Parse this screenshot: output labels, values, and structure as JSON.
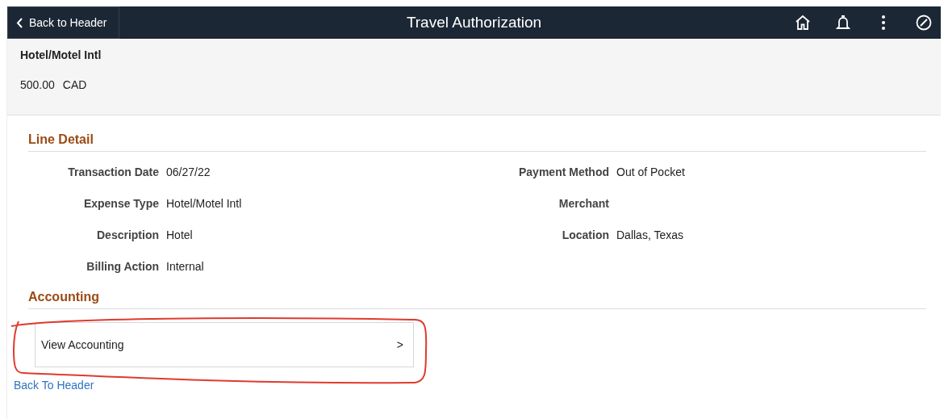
{
  "header": {
    "back_button": "Back to Header",
    "title": "Travel Authorization"
  },
  "summary": {
    "name": "Hotel/Motel Intl",
    "amount": "500.00",
    "currency": "CAD"
  },
  "line_detail": {
    "heading": "Line Detail",
    "left_fields": [
      {
        "label": "Transaction Date",
        "value": "06/27/22"
      },
      {
        "label": "Expense Type",
        "value": "Hotel/Motel Intl"
      },
      {
        "label": "Description",
        "value": "Hotel"
      },
      {
        "label": "Billing Action",
        "value": "Internal"
      }
    ],
    "right_fields": [
      {
        "label": "Payment Method",
        "value": "Out of Pocket"
      },
      {
        "label": "Merchant"
      },
      {
        "label": "Location",
        "value": "Dallas, Texas"
      }
    ]
  },
  "accounting": {
    "heading": "Accounting",
    "button": "View Accounting",
    "chevron": ">",
    "highlighted": true
  },
  "back_link": "Back To Header"
}
